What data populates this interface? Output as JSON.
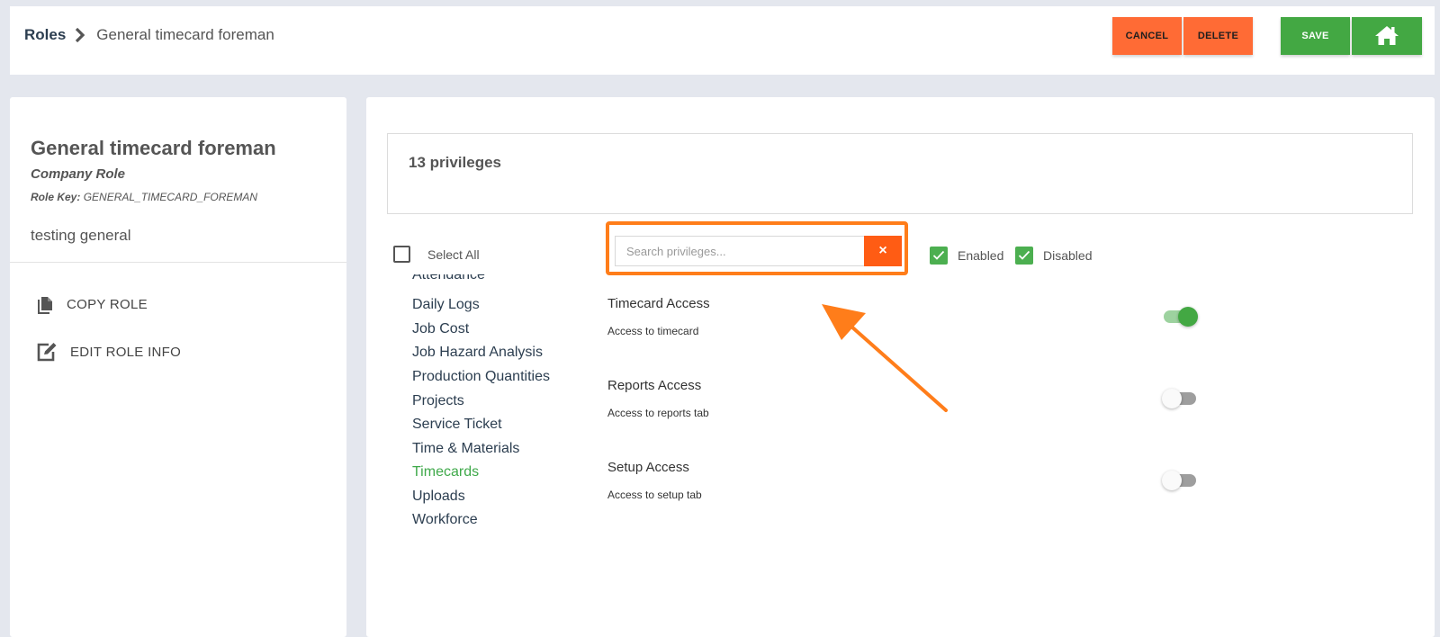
{
  "header": {
    "breadcrumb_root": "Roles",
    "breadcrumb_current": "General timecard foreman",
    "cancel_label": "CANCEL",
    "delete_label": "DELETE",
    "save_label": "SAVE",
    "home_icon": "home-icon"
  },
  "role": {
    "title": "General timecard foreman",
    "type": "Company Role",
    "key_label": "Role Key:",
    "key_value": "GENERAL_TIMECARD_FOREMAN",
    "description": "testing general"
  },
  "actions": {
    "copy_label": "COPY ROLE",
    "edit_label": "EDIT ROLE INFO"
  },
  "privileges": {
    "count_text": "13 privileges",
    "select_all_label": "Select All",
    "search_placeholder": "Search privileges...",
    "clear_icon": "×",
    "filter_enabled_label": "Enabled",
    "filter_disabled_label": "Disabled",
    "categories": [
      "Attendance",
      "Daily Logs",
      "Job Cost",
      "Job Hazard Analysis",
      "Production Quantities",
      "Projects",
      "Service Ticket",
      "Time & Materials",
      "Timecards",
      "Uploads",
      "Workforce"
    ],
    "active_category": "Timecards",
    "items": [
      {
        "title": "Timecard Access",
        "description": "Access to timecard",
        "enabled": true
      },
      {
        "title": "Reports Access",
        "description": "Access to reports tab",
        "enabled": false
      },
      {
        "title": "Setup Access",
        "description": "Access to setup tab",
        "enabled": false
      }
    ]
  },
  "colors": {
    "accent_orange": "#ff6b35",
    "accent_green": "#43a843",
    "annotation_orange": "#ff7d1a"
  }
}
